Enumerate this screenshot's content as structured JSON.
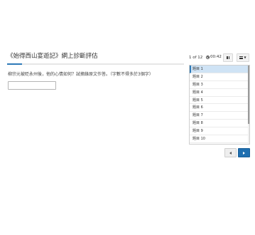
{
  "header": {
    "title": "《始得西山宴遊記》網上診斷評估"
  },
  "progress": {
    "fraction": 0.084,
    "color": "#2e7ab8"
  },
  "question": {
    "text": "柳宗元被貶永州後，他的心情如何？試摘錄原文作答。（字數不得多於3個字）",
    "answer_value": "",
    "answer_placeholder": ""
  },
  "status": {
    "counter": "1 of 12",
    "timer": "00:42",
    "pause_icon": "pause-icon",
    "list_icon": "list-icon"
  },
  "question_list": {
    "items": [
      "題目 1",
      "題目 2",
      "題目 3",
      "題目 4",
      "題目 5",
      "題目 6",
      "題目 7",
      "題目 8",
      "題目 9",
      "題目 10"
    ],
    "active_index": 0
  },
  "navigation": {
    "prev_icon": "caret-left-icon",
    "next_icon": "caret-right-icon",
    "accent": "#1f6fb0"
  }
}
